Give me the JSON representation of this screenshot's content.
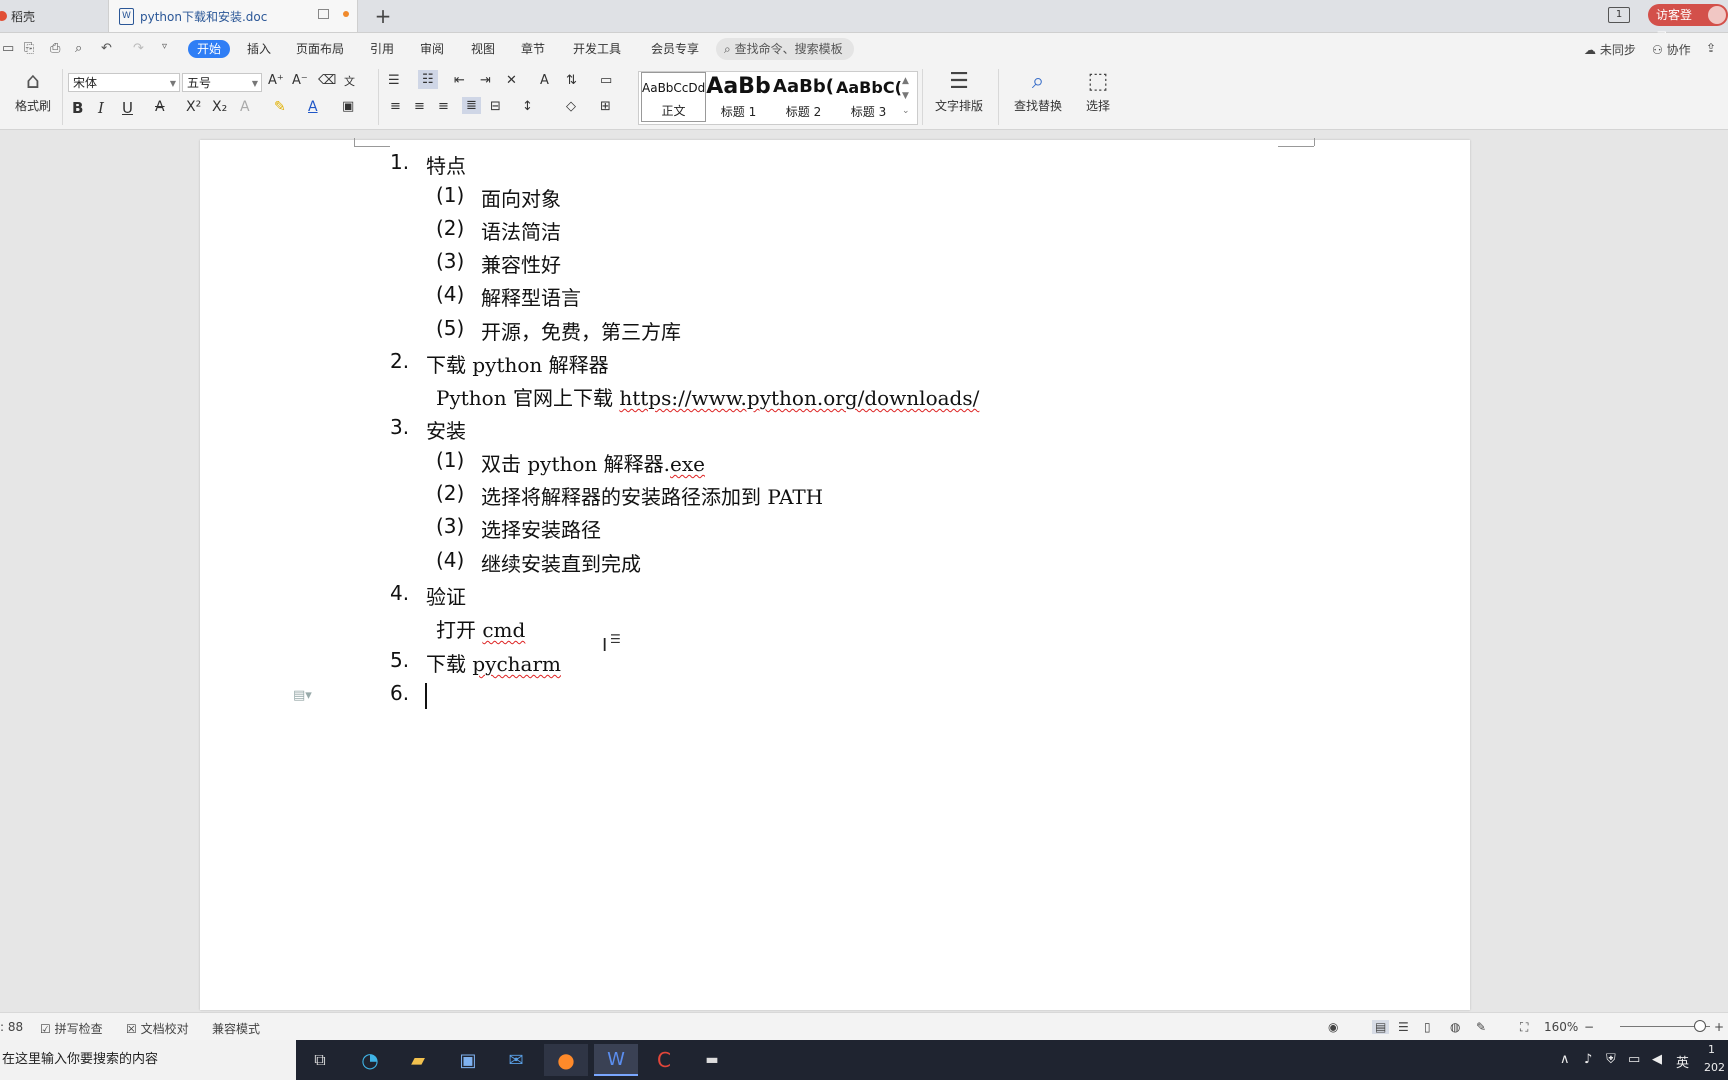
{
  "tabs": {
    "home_label": "稻壳",
    "doc_title": "python下载和安装.doc"
  },
  "titlebar": {
    "login_label": "访客登录",
    "page_indicator": "1"
  },
  "menu": {
    "items": [
      "开始",
      "插入",
      "页面布局",
      "引用",
      "审阅",
      "视图",
      "章节",
      "开发工具",
      "会员专享"
    ],
    "search_placeholder": "查找命令、搜索模板",
    "sync_label": "未同步",
    "collab_label": "协作"
  },
  "ribbon": {
    "format_painter": "格式刷",
    "font_name": "宋体",
    "font_size": "五号",
    "styles": [
      {
        "sample": "AaBbCcDd",
        "label": "正文"
      },
      {
        "sample": "AaBb",
        "label": "标题 1"
      },
      {
        "sample": "AaBb(",
        "label": "标题 2"
      },
      {
        "sample": "AaBbC(",
        "label": "标题 3"
      }
    ],
    "text_layout": "文字排版",
    "find_replace": "查找替换",
    "select": "选择"
  },
  "document": {
    "lines": [
      {
        "num": "1.",
        "text": "特点"
      },
      {
        "num": "(1)",
        "text": "面向对象"
      },
      {
        "num": "(2)",
        "text": "语法简洁"
      },
      {
        "num": "(3)",
        "text": "兼容性好"
      },
      {
        "num": "(4)",
        "text": "解释型语言"
      },
      {
        "num": "(5)",
        "text": "开源，免费，第三方库"
      },
      {
        "num": "2.",
        "text": "下载 python 解释器"
      },
      {
        "num": "",
        "text_a": "Python 官网上下载 ",
        "text_b": "https://www.python.org/downloads/"
      },
      {
        "num": "3.",
        "text": "安装"
      },
      {
        "num": "(1)",
        "text_a": "双击 python 解释器.",
        "text_b": "exe"
      },
      {
        "num": "(2)",
        "text": "选择将解释器的安装路径添加到 PATH"
      },
      {
        "num": "(3)",
        "text": "选择安装路径"
      },
      {
        "num": "(4)",
        "text": "继续安装直到完成"
      },
      {
        "num": "4.",
        "text": "验证"
      },
      {
        "num": "",
        "text_a": "打开 ",
        "text_b": "cmd"
      },
      {
        "num": "5.",
        "text_a": "下载 ",
        "text_b": "pycharm"
      },
      {
        "num": "6.",
        "text": ""
      }
    ]
  },
  "statusbar": {
    "word_count": ": 88",
    "spell_check": "拼写检查",
    "doc_proof": "文档校对",
    "compat_mode": "兼容模式",
    "zoom": "160%"
  },
  "taskbar": {
    "search_placeholder": "在这里输入你要搜索的内容",
    "ime_label": "英",
    "clock_time": "1",
    "clock_date": "202"
  }
}
